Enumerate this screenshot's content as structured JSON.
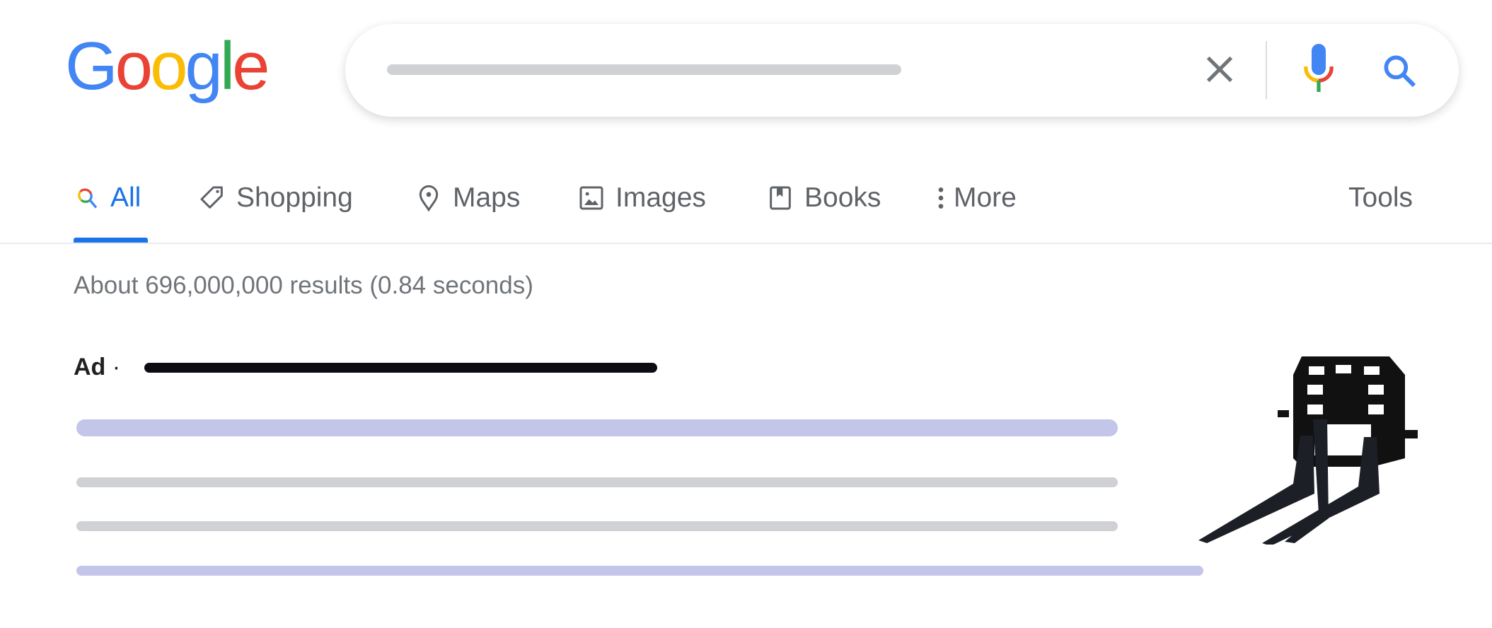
{
  "logo": {
    "text": "Google",
    "letters": [
      "G",
      "o",
      "o",
      "g",
      "l",
      "e"
    ],
    "colors": [
      "#4285f4",
      "#ea4335",
      "#fbbc05",
      "#4285f4",
      "#34a853",
      "#ea4335"
    ]
  },
  "search": {
    "query": "",
    "clear_icon": "close-icon",
    "voice_icon": "mic-icon",
    "search_icon": "search-icon"
  },
  "tabs": [
    {
      "label": "All",
      "icon": "search-icon",
      "active": true
    },
    {
      "label": "Shopping",
      "icon": "tag-icon"
    },
    {
      "label": "Maps",
      "icon": "map-pin-icon"
    },
    {
      "label": "Images",
      "icon": "image-icon"
    },
    {
      "label": "Books",
      "icon": "book-icon"
    },
    {
      "label": "More",
      "icon": "more-vert-icon"
    }
  ],
  "tools_label": "Tools",
  "result_stats": "About 696,000,000 results (0.84 seconds)",
  "ad": {
    "label": "Ad",
    "separator": "·",
    "image": "pallet-fork-attachment"
  },
  "colors": {
    "accent": "#1a73e8",
    "link_placeholder": "#c3c5e9",
    "text_placeholder": "#d0d1d4"
  }
}
